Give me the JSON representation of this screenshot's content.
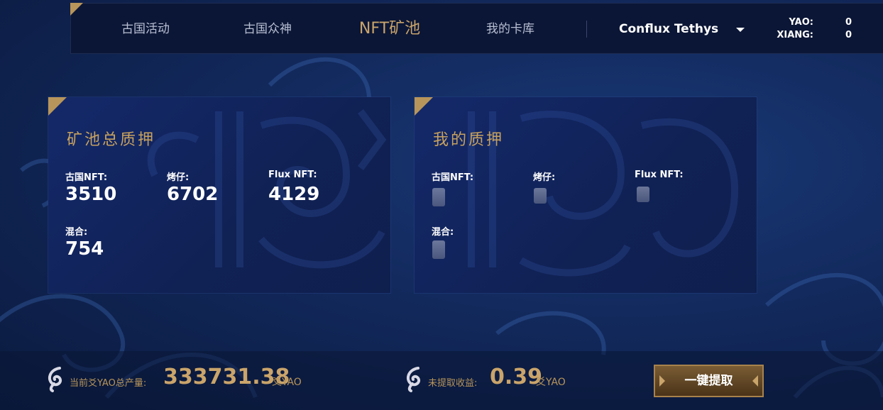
{
  "nav": {
    "items": [
      {
        "label": "古国活动",
        "active": false
      },
      {
        "label": "古国众神",
        "active": false
      },
      {
        "label": "NFT矿池",
        "active": true
      },
      {
        "label": "我的卡库",
        "active": false
      }
    ],
    "wallet": "Conflux Tethys",
    "balances": [
      {
        "label": "YAO:",
        "value": "0"
      },
      {
        "label": "XIANG:",
        "value": "0"
      }
    ]
  },
  "pool_total": {
    "title": "矿池总质押",
    "stats": [
      {
        "label": "古国NFT:",
        "value": "3510"
      },
      {
        "label": "烤仔:",
        "value": "6702"
      },
      {
        "label": "Flux NFT:",
        "value": "4129"
      },
      {
        "label": "混合:",
        "value": "754"
      }
    ]
  },
  "my_stake": {
    "title": "我的质押",
    "stats": [
      {
        "label": "古国NFT:"
      },
      {
        "label": "烤仔:"
      },
      {
        "label": "Flux NFT:"
      },
      {
        "label": "混合:"
      }
    ]
  },
  "footer": {
    "total_label": "当前爻YAO总产量:",
    "total_value": "333731.38",
    "total_unit": "爻YAO",
    "unclaimed_label": "未提取收益:",
    "unclaimed_value": "0.39",
    "unclaimed_unit": "爻YAO",
    "claim_button": "一键提取"
  },
  "colors": {
    "gold": "#caa46a",
    "nav_bg": "#0b1636",
    "panel_bg": "#13286a"
  }
}
